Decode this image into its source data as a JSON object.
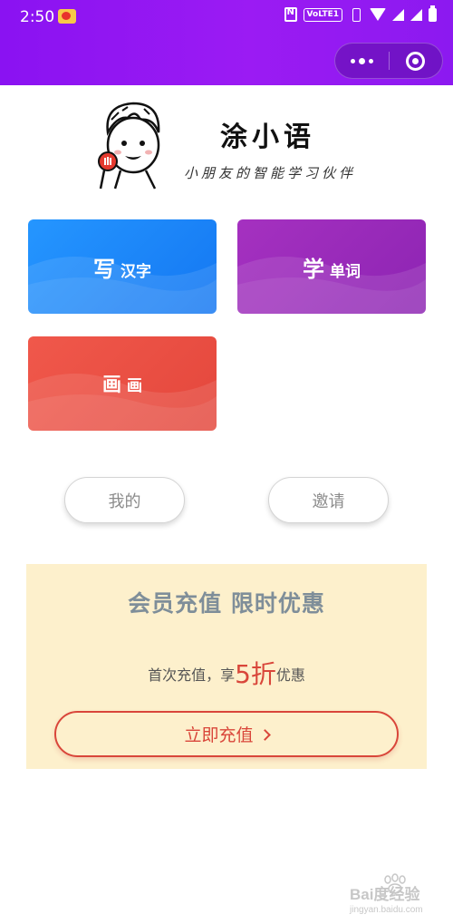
{
  "status_bar": {
    "time": "2:50",
    "network_badge": "VoLTE1",
    "icons": [
      "weibo-icon",
      "nfc-icon",
      "vibrate-icon",
      "wifi-icon",
      "signal-icon",
      "battery-icon"
    ]
  },
  "nav": {
    "capsule_icons": [
      "more-dots-icon",
      "target-close-icon"
    ],
    "color": "#9b1bf3"
  },
  "logo": {
    "app_name": "涂小语",
    "slogan": "小朋友的智能学习伙伴"
  },
  "cards": [
    {
      "big": "写",
      "small": "汉字",
      "color": "#1e88ff"
    },
    {
      "big": "学",
      "small": "单词",
      "color": "#9b2bbb"
    },
    {
      "big": "画",
      "small": "画",
      "color": "#ea4e42"
    }
  ],
  "buttons": {
    "mine": "我的",
    "invite": "邀请"
  },
  "promo": {
    "title": "会员充值 限时优惠",
    "sub_before": "首次充值，享",
    "sub_number": "5",
    "sub_char": "折",
    "sub_after": "优惠",
    "cta_label": "立即充值",
    "background": "#fdf0cc",
    "accent": "#d9463a"
  },
  "watermark": {
    "brand": "Bai度经验",
    "url": "jingyan.baidu.com"
  }
}
